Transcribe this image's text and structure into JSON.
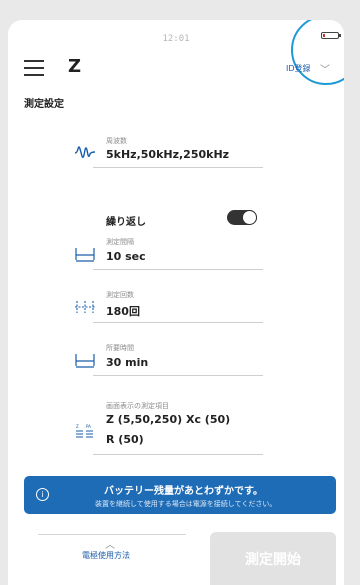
{
  "status_bar": {
    "time": "12:01",
    "battery_icon": "battery-low-icon"
  },
  "header": {
    "menu_icon": "hamburger-menu-icon",
    "title": "Z",
    "id_register": "ID登録",
    "chevron_icon": "chevron-down-icon"
  },
  "section_title": "測定設定",
  "settings": {
    "frequency": {
      "icon": "wave-icon",
      "label": "周波数",
      "value": "5kHz,50kHz,250kHz"
    },
    "repeat": {
      "label": "繰り返し",
      "enabled": true
    },
    "interval": {
      "icon": "interval-icon",
      "label": "測定間隔",
      "value": "10 sec"
    },
    "count": {
      "icon": "count-icon",
      "label": "測定回数",
      "value": "180回"
    },
    "duration": {
      "icon": "duration-icon",
      "label": "所要時間",
      "value": "30 min"
    },
    "display_items": {
      "icon": "display-items-icon",
      "label": "画面表示の測定項目",
      "value_line1": "Z (5,50,250) Xc (50)",
      "value_line2": "R (50)"
    }
  },
  "banner": {
    "icon": "info-icon",
    "main": "バッテリー残量があとわずかです。",
    "sub": "装置を継続して使用する場合は電源を接続してください。",
    "color": "#1e6cb6"
  },
  "footer": {
    "electrode_label": "電極使用方法",
    "chevron_icon": "chevron-up-icon",
    "start_button": "測定開始"
  }
}
